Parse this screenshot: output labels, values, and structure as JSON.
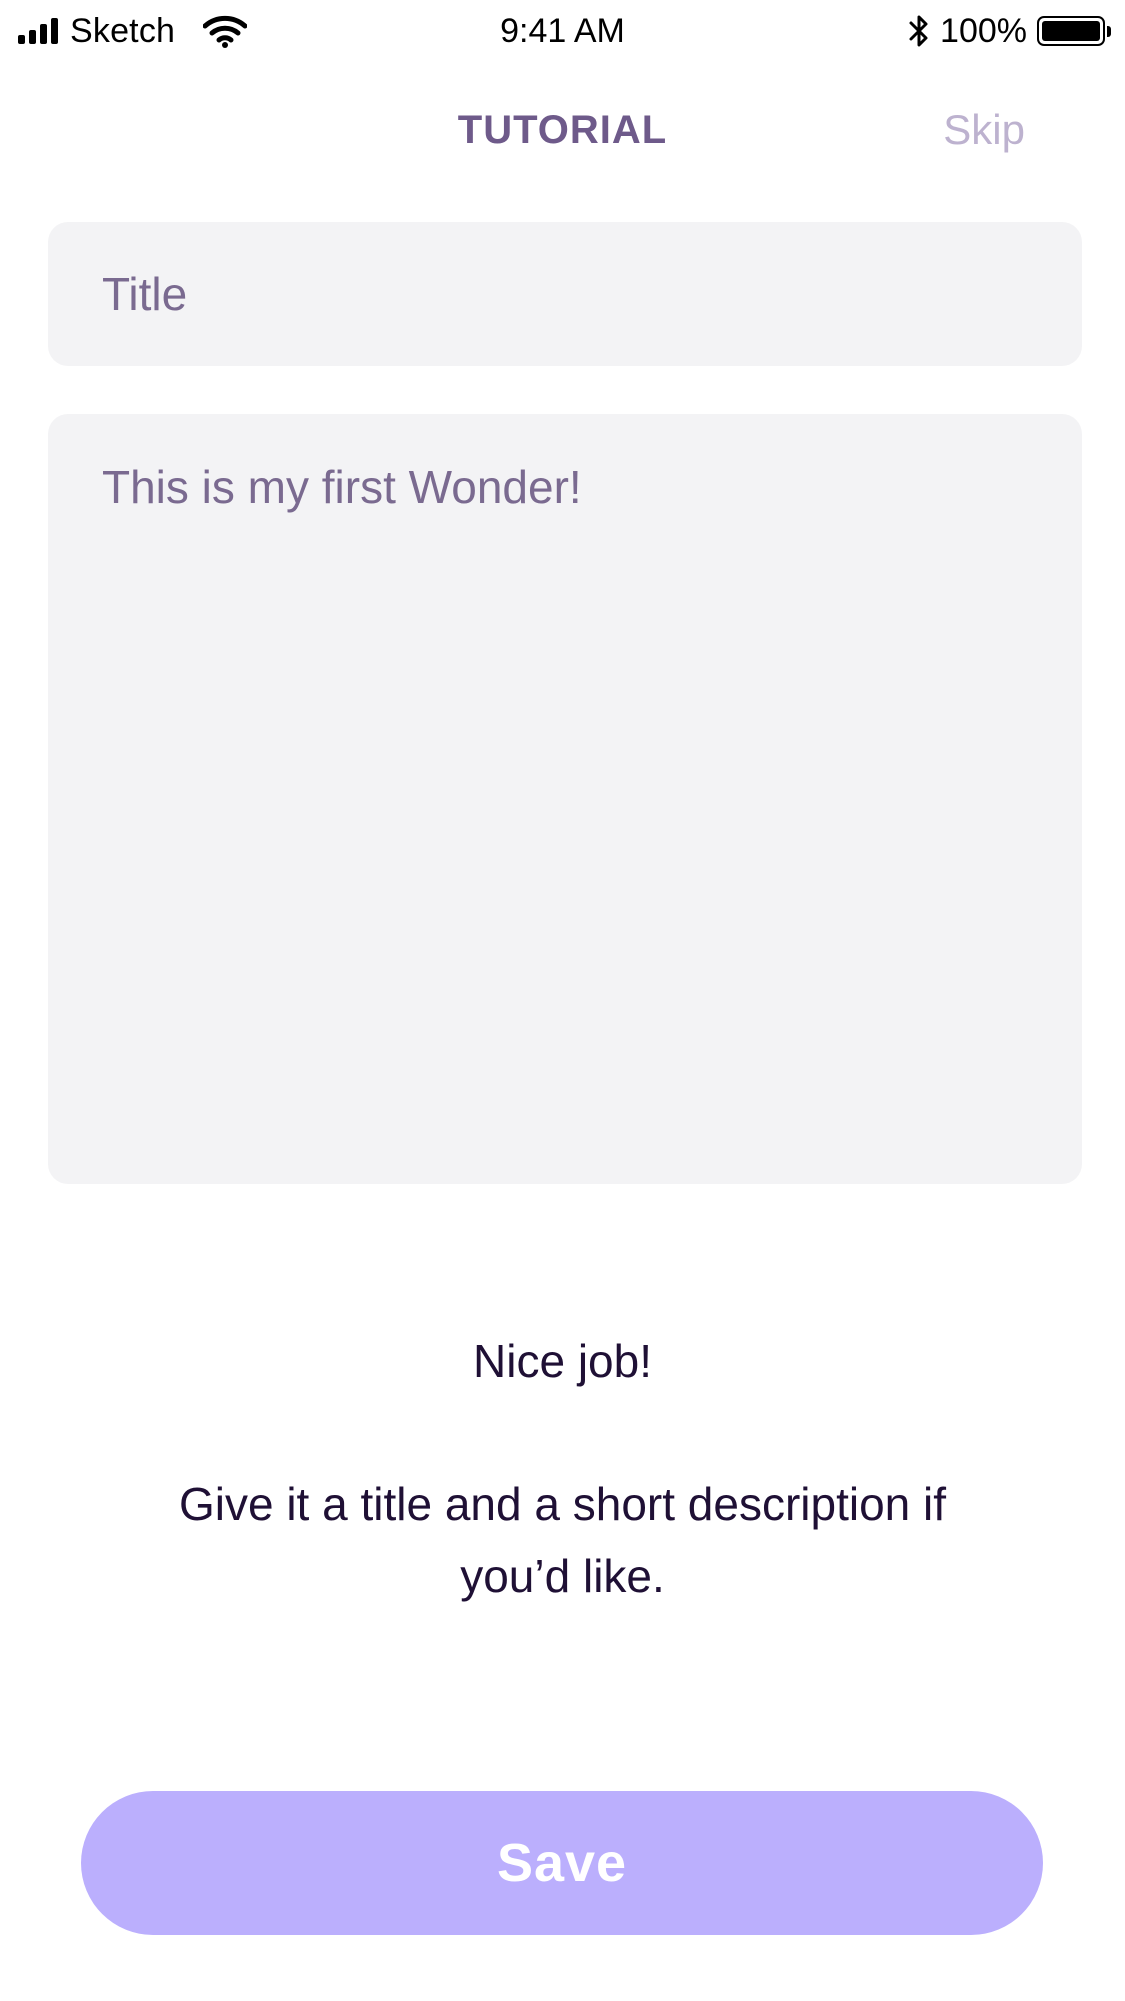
{
  "status_bar": {
    "carrier": "Sketch",
    "time": "9:41 AM",
    "battery_percent": "100%",
    "battery_level": 1.0,
    "icons": [
      "signal-icon",
      "wifi-icon",
      "bluetooth-icon",
      "battery-icon"
    ]
  },
  "header": {
    "title": "TUTORIAL",
    "skip_label": "Skip"
  },
  "form": {
    "title_placeholder": "Title",
    "description_value": "This is my first Wonder!"
  },
  "messages": {
    "heading": "Nice job!",
    "instruction": "Give it a title and a short description if you’d like."
  },
  "actions": {
    "save_label": "Save"
  },
  "colors": {
    "accent": "#bbaffd",
    "title_text": "#6e5a8a",
    "skip_text": "#bdb2cf",
    "body_text": "#1f1035",
    "field_bg": "#f3f3f5"
  }
}
